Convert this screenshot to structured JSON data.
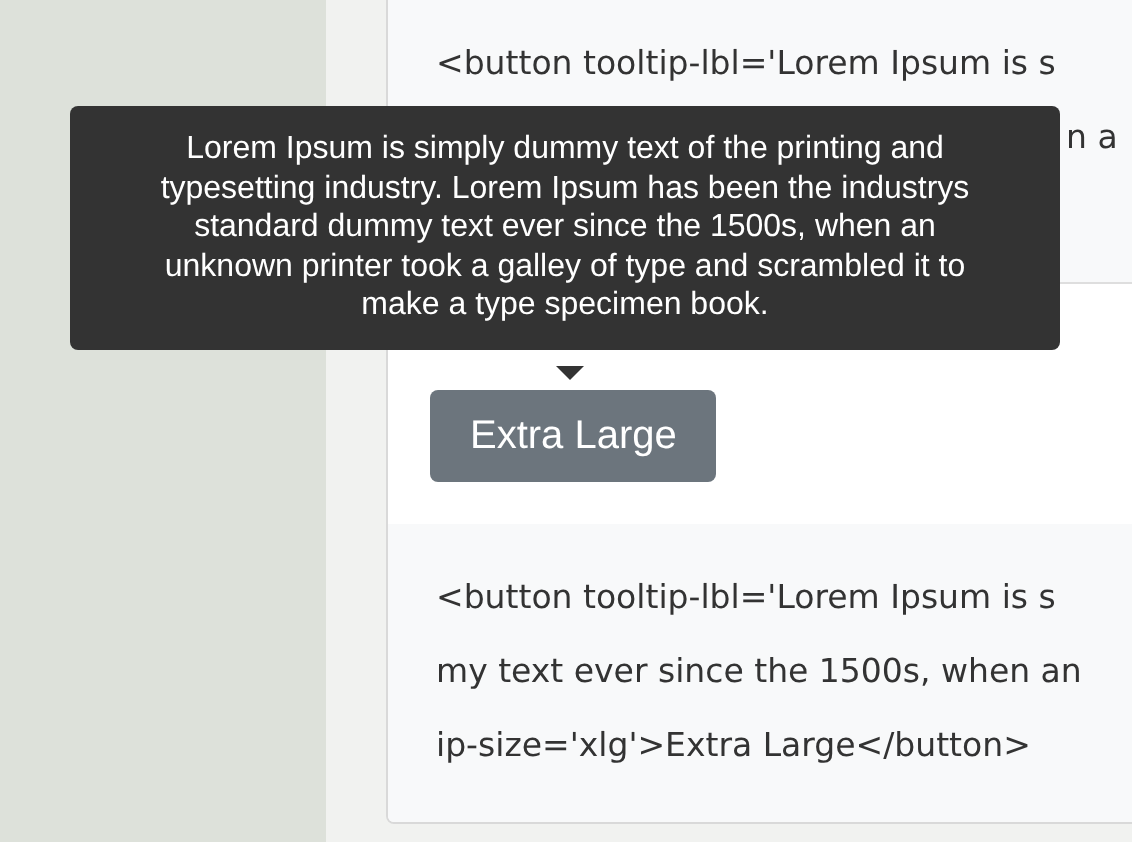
{
  "top_code": {
    "lines": [
      "<button tooltip-lbl='Lorem Ipsum is s",
      "n a"
    ]
  },
  "example": {
    "button": "Extra Large",
    "tooltip": "Lorem Ipsum is simply dummy text of the printing and typesetting industry. Lorem Ipsum has been the industrys standard dummy text ever since the 1500s, when an unknown printer took a galley of type and scrambled it to make a type specimen book."
  },
  "bottom_code": {
    "lines": [
      "<button tooltip-lbl='Lorem Ipsum is s",
      "my text ever since the 1500s, when an",
      "ip-size='xlg'>Extra Large</button>"
    ]
  }
}
